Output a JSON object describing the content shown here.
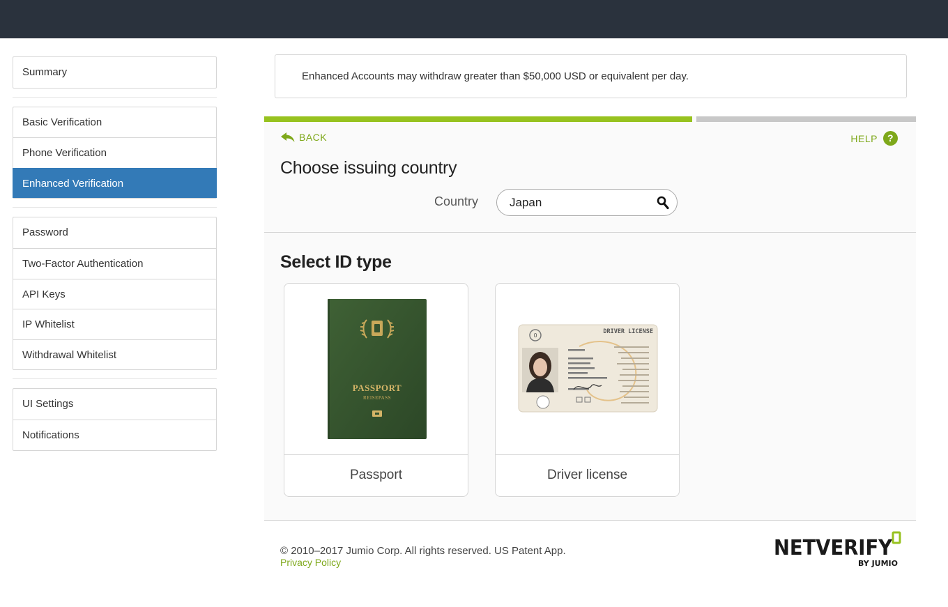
{
  "sidebar": {
    "groups": [
      {
        "items": [
          {
            "label": "Summary"
          }
        ]
      },
      {
        "items": [
          {
            "label": "Basic Verification"
          },
          {
            "label": "Phone Verification"
          },
          {
            "label": "Enhanced Verification",
            "active": true
          }
        ]
      },
      {
        "items": [
          {
            "label": "Password"
          },
          {
            "label": "Two-Factor Authentication"
          },
          {
            "label": "API Keys"
          },
          {
            "label": "IP Whitelist"
          },
          {
            "label": "Withdrawal Whitelist"
          }
        ]
      },
      {
        "items": [
          {
            "label": "UI Settings"
          },
          {
            "label": "Notifications"
          }
        ]
      }
    ]
  },
  "notice": {
    "text": "Enhanced Accounts may withdraw greater than $50,000 USD or equivalent per day."
  },
  "verify": {
    "progress_fraction": 0.657,
    "back_label": "BACK",
    "help_label": "HELP",
    "help_icon_glyph": "?",
    "country_heading": "Choose issuing country",
    "country_label": "Country",
    "country_value": "Japan",
    "idtype_heading": "Select ID type",
    "id_types": [
      {
        "label": "Passport",
        "cover_title": "PASSPORT",
        "cover_subtitle": "REISEPASS"
      },
      {
        "label": "Driver license",
        "card_title": "DRIVER LICENSE"
      }
    ]
  },
  "footer": {
    "copyright": "© 2010–2017 Jumio Corp. All rights reserved. US Patent App.",
    "privacy_label": "Privacy Policy",
    "logo_main": "NETVERIFY",
    "logo_sub": "BY JUMIO"
  },
  "colors": {
    "topbar": "#2a323d",
    "accent_green": "#97c21f",
    "link_green": "#7ea81a",
    "active_blue": "#337ab7"
  }
}
